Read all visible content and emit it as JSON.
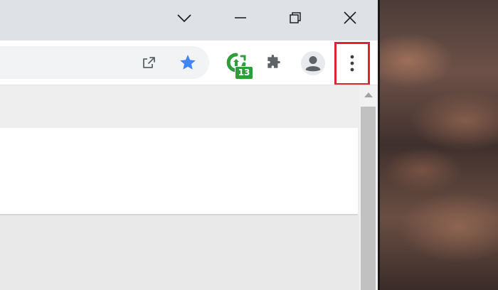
{
  "window": {
    "controls": [
      {
        "name": "tab-search-button",
        "icon": "chevron-down-icon"
      },
      {
        "name": "minimize-button",
        "icon": "minimize-icon"
      },
      {
        "name": "restore-button",
        "icon": "restore-icon"
      },
      {
        "name": "close-button",
        "icon": "close-icon"
      }
    ]
  },
  "toolbar": {
    "share_icon": "share-icon",
    "bookmark_icon": "star-icon",
    "bookmark_color": "#4285f4",
    "extension": {
      "icon": "green-extension-icon",
      "badge": "13",
      "color": "#2e9e38"
    },
    "extensions_icon": "puzzle-icon",
    "profile_icon": "person-icon",
    "menu_icon": "three-dot-menu-icon",
    "menu_highlight_color": "#d9282f"
  }
}
